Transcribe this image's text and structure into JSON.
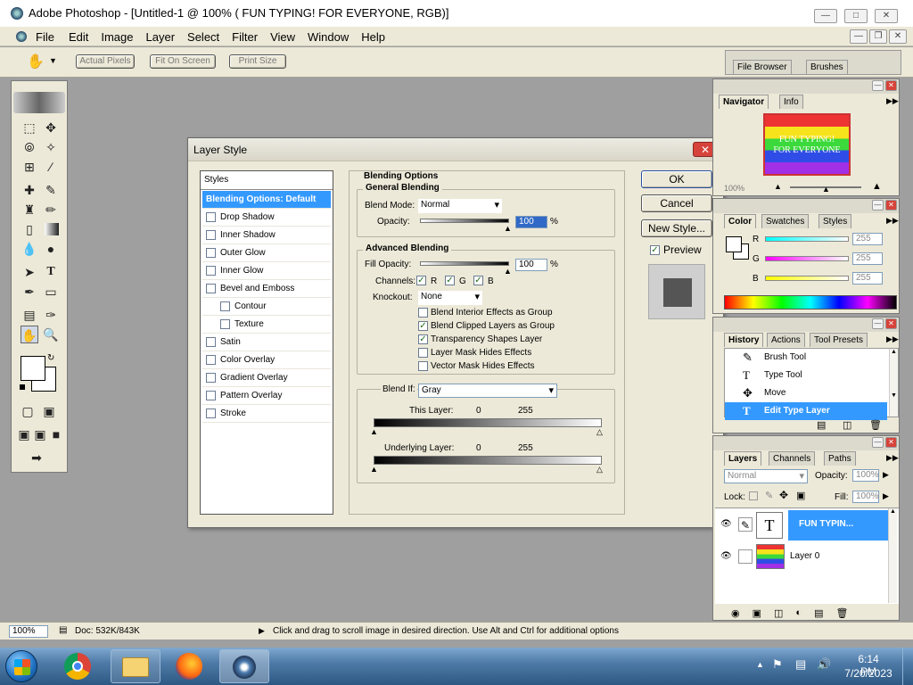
{
  "titlebar": {
    "title": "Adobe Photoshop - [Untitled-1 @ 100% (  FUN TYPING! FOR EVERYONE, RGB)]"
  },
  "menu": [
    "File",
    "Edit",
    "Image",
    "Layer",
    "Select",
    "Filter",
    "View",
    "Window",
    "Help"
  ],
  "options_bar": {
    "actual_pixels": "Actual Pixels",
    "fit_on_screen": "Fit On Screen",
    "print_size": "Print Size"
  },
  "palette_well": {
    "file_browser": "File Browser",
    "brushes": "Brushes"
  },
  "dialog": {
    "title": "Layer Style",
    "styles_header": "Styles",
    "styles": [
      {
        "label": "Blending Options: Default",
        "selected": true,
        "checkbox": false
      },
      {
        "label": "Drop Shadow",
        "checked": false
      },
      {
        "label": "Inner Shadow",
        "checked": false
      },
      {
        "label": "Outer Glow",
        "checked": false
      },
      {
        "label": "Inner Glow",
        "checked": false
      },
      {
        "label": "Bevel and Emboss",
        "checked": false
      },
      {
        "label": "Contour",
        "checked": false,
        "indent": true
      },
      {
        "label": "Texture",
        "checked": false,
        "indent": true
      },
      {
        "label": "Satin",
        "checked": false
      },
      {
        "label": "Color Overlay",
        "checked": false
      },
      {
        "label": "Gradient Overlay",
        "checked": false
      },
      {
        "label": "Pattern Overlay",
        "checked": false
      },
      {
        "label": "Stroke",
        "checked": false
      }
    ],
    "blending_options": {
      "title": "Blending Options",
      "general_title": "General Blending",
      "blend_mode_label": "Blend Mode:",
      "blend_mode": "Normal",
      "opacity_label": "Opacity:",
      "opacity_value": "100",
      "opacity_unit": "%",
      "opacity_fraction": 1.0,
      "advanced_title": "Advanced Blending",
      "fill_opacity_label": "Fill Opacity:",
      "fill_opacity_value": "100",
      "fill_opacity_unit": "%",
      "channels_label": "Channels:",
      "channel_r": "R",
      "channel_g": "G",
      "channel_b": "B",
      "knockout_label": "Knockout:",
      "knockout": "None",
      "options": [
        {
          "label": "Blend Interior Effects as Group",
          "checked": false
        },
        {
          "label": "Blend Clipped Layers as Group",
          "checked": true
        },
        {
          "label": "Transparency Shapes Layer",
          "checked": true
        },
        {
          "label": "Layer Mask Hides Effects",
          "checked": false
        },
        {
          "label": "Vector Mask Hides Effects",
          "checked": false
        }
      ],
      "blend_if_label": "Blend If:",
      "blend_if": "Gray",
      "this_layer_label": "This Layer:",
      "this_layer_min": "0",
      "this_layer_max": "255",
      "underlying_label": "Underlying Layer:",
      "underlying_min": "0",
      "underlying_max": "255"
    },
    "buttons": {
      "ok": "OK",
      "cancel": "Cancel",
      "new_style": "New Style...",
      "preview": "Preview"
    }
  },
  "navigator": {
    "tab_navigator": "Navigator",
    "tab_info": "Info",
    "thumb_line1": "FUN TYPING!",
    "thumb_line2": "FOR EVERYONE",
    "zoom": "100%"
  },
  "color": {
    "tab_color": "Color",
    "tab_swatches": "Swatches",
    "tab_styles": "Styles",
    "r_label": "R",
    "g_label": "G",
    "b_label": "B",
    "r": "255",
    "g": "255",
    "b": "255"
  },
  "history": {
    "tab_history": "History",
    "tab_actions": "Actions",
    "tab_presets": "Tool Presets",
    "items": [
      {
        "label": "Brush Tool",
        "icon": "brush-icon"
      },
      {
        "label": "Type Tool",
        "icon": "type-icon"
      },
      {
        "label": "Move",
        "icon": "move-icon"
      },
      {
        "label": "Edit Type Layer",
        "icon": "type-icon",
        "selected": true
      }
    ]
  },
  "layers": {
    "tab_layers": "Layers",
    "tab_channels": "Channels",
    "tab_paths": "Paths",
    "blend_mode": "Normal",
    "opacity_label": "Opacity:",
    "opacity": "100%",
    "lock_label": "Lock:",
    "fill_label": "Fill:",
    "fill": "100%",
    "items": [
      {
        "name": "FUN TYPIN...",
        "type": "text",
        "selected": true
      },
      {
        "name": "Layer 0",
        "type": "image",
        "selected": false
      }
    ]
  },
  "statusbar": {
    "zoom": "100%",
    "doc": "Doc: 532K/843K",
    "hint": "Click and drag to scroll image in desired direction.  Use Alt and Ctrl for additional options"
  },
  "taskbar": {
    "time": "6:14 PM",
    "date": "7/20/2023"
  },
  "colors": {
    "selection_blue": "#3399ff",
    "dialog_bg": "#ece9d8",
    "workspace": "#9f9f9f"
  }
}
